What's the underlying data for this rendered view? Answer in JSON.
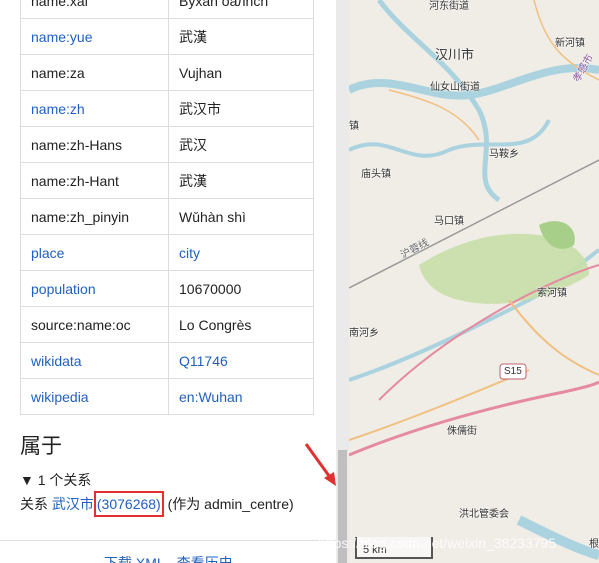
{
  "tags": [
    {
      "key": "name:xal",
      "value": "Byxan oaлnch",
      "key_link": false,
      "value_link": false
    },
    {
      "key": "name:yue",
      "value": "武漢",
      "key_link": true,
      "value_link": false
    },
    {
      "key": "name:za",
      "value": "Vujhan",
      "key_link": false,
      "value_link": false
    },
    {
      "key": "name:zh",
      "value": "武汉市",
      "key_link": true,
      "value_link": false
    },
    {
      "key": "name:zh-Hans",
      "value": "武汉",
      "key_link": false,
      "value_link": false
    },
    {
      "key": "name:zh-Hant",
      "value": "武漢",
      "key_link": false,
      "value_link": false
    },
    {
      "key": "name:zh_pinyin",
      "value": "Wǔhàn shì",
      "key_link": false,
      "value_link": false
    },
    {
      "key": "place",
      "value": "city",
      "key_link": true,
      "value_link": true
    },
    {
      "key": "population",
      "value": "10670000",
      "key_link": true,
      "value_link": false
    },
    {
      "key": "source:name:oc",
      "value": "Lo Congrès",
      "key_link": false,
      "value_link": false
    },
    {
      "key": "wikidata",
      "value": "Q11746",
      "key_link": true,
      "value_link": true
    },
    {
      "key": "wikipedia",
      "value": "en:Wuhan",
      "key_link": true,
      "value_link": true
    }
  ],
  "membership": {
    "heading": "属于",
    "toggle": "▼ 1 个关系",
    "prefix": "关系",
    "relation_name": "武汉市",
    "relation_id": "(3076268)",
    "role": "(作为 admin_centre)"
  },
  "footer": {
    "links": "下载 XML · 查看历史"
  },
  "map": {
    "scale": "5 km",
    "labels": [
      "河东街道",
      "汉川市",
      "新河镇",
      "仙女山街道",
      "孝感市",
      "镇",
      "马鞍乡",
      "庙头镇",
      "马口镇",
      "沪蓉线",
      "索河镇",
      "南河乡",
      "S15",
      "侏儒街",
      "洪北管委会",
      "根"
    ]
  },
  "watermark": "https://blog.csdn.net/weixin_38233795",
  "colors": {
    "link": "#2060c0",
    "highlight": "#e03030",
    "arrow": "#e03030",
    "water": "#aad3df",
    "park": "#c8dfa8"
  }
}
